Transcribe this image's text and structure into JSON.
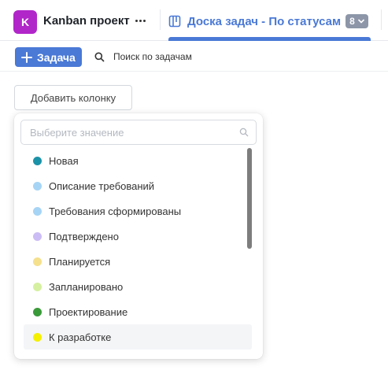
{
  "header": {
    "project_avatar_letter": "K",
    "project_name": "Kanban проект",
    "tab": {
      "label": "Доска задач - По статусам",
      "badge_count": "8"
    }
  },
  "toolbar": {
    "add_task_label": "Задача",
    "search_label": "Поиск по задачам"
  },
  "board": {
    "add_column_label": "Добавить колонку"
  },
  "dropdown": {
    "search_placeholder": "Выберите значение",
    "options": [
      {
        "label": "Новая",
        "color": "#1b92a8"
      },
      {
        "label": "Описание требований",
        "color": "#a6d4f5"
      },
      {
        "label": "Требования сформированы",
        "color": "#a6d4f5"
      },
      {
        "label": "Подтверждено",
        "color": "#cbbcf5"
      },
      {
        "label": "Планируется",
        "color": "#f5e08d"
      },
      {
        "label": "Запланировано",
        "color": "#d5f0a0"
      },
      {
        "label": "Проектирование",
        "color": "#3a9a3a"
      },
      {
        "label": "К разработке",
        "color": "#f4f000"
      }
    ],
    "highlighted_index": 7
  },
  "colors": {
    "accent": "#4a79d6",
    "project_avatar": "#b126c9",
    "badge": "#8c96a8"
  }
}
